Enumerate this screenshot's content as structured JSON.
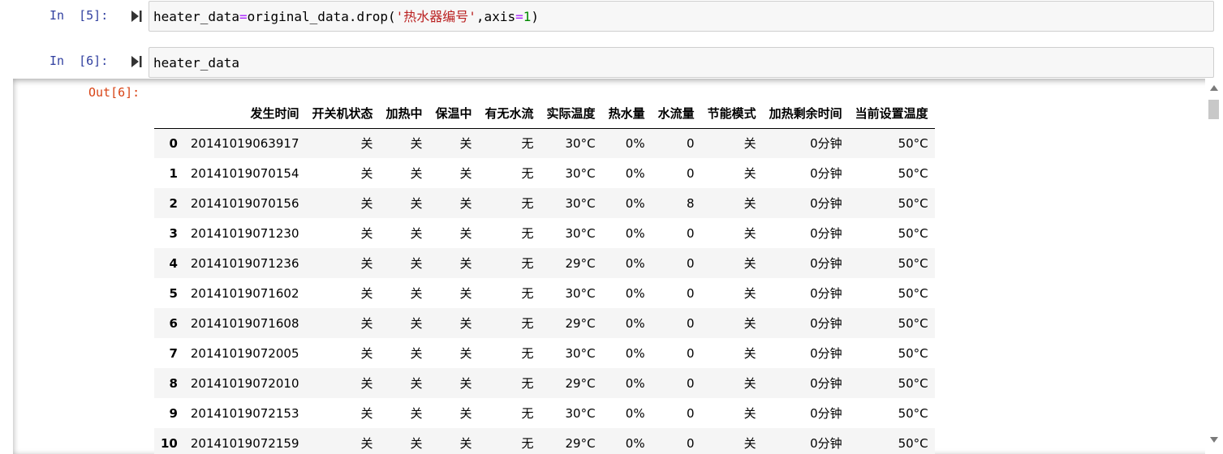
{
  "cells": [
    {
      "prompt": "In  [5]:",
      "code_tokens": [
        {
          "t": "heater_data",
          "c": ""
        },
        {
          "t": "=",
          "c": "op"
        },
        {
          "t": "original_data.drop(",
          "c": ""
        },
        {
          "t": "'热水器编号'",
          "c": "str"
        },
        {
          "t": ",axis",
          "c": ""
        },
        {
          "t": "=",
          "c": "op"
        },
        {
          "t": "1",
          "c": "num"
        },
        {
          "t": ")",
          "c": ""
        }
      ]
    },
    {
      "prompt": "In  [6]:",
      "code_tokens": [
        {
          "t": "heater_data",
          "c": ""
        }
      ]
    }
  ],
  "output": {
    "prompt": "Out[6]:",
    "columns": [
      "发生时间",
      "开关机状态",
      "加热中",
      "保温中",
      "有无水流",
      "实际温度",
      "热水量",
      "水流量",
      "节能模式",
      "加热剩余时间",
      "当前设置温度"
    ],
    "rows": [
      {
        "index": "0",
        "cells": [
          "20141019063917",
          "关",
          "关",
          "关",
          "无",
          "30°C",
          "0%",
          "0",
          "关",
          "0分钟",
          "50°C"
        ]
      },
      {
        "index": "1",
        "cells": [
          "20141019070154",
          "关",
          "关",
          "关",
          "无",
          "30°C",
          "0%",
          "0",
          "关",
          "0分钟",
          "50°C"
        ]
      },
      {
        "index": "2",
        "cells": [
          "20141019070156",
          "关",
          "关",
          "关",
          "无",
          "30°C",
          "0%",
          "8",
          "关",
          "0分钟",
          "50°C"
        ]
      },
      {
        "index": "3",
        "cells": [
          "20141019071230",
          "关",
          "关",
          "关",
          "无",
          "30°C",
          "0%",
          "0",
          "关",
          "0分钟",
          "50°C"
        ]
      },
      {
        "index": "4",
        "cells": [
          "20141019071236",
          "关",
          "关",
          "关",
          "无",
          "29°C",
          "0%",
          "0",
          "关",
          "0分钟",
          "50°C"
        ]
      },
      {
        "index": "5",
        "cells": [
          "20141019071602",
          "关",
          "关",
          "关",
          "无",
          "30°C",
          "0%",
          "0",
          "关",
          "0分钟",
          "50°C"
        ]
      },
      {
        "index": "6",
        "cells": [
          "20141019071608",
          "关",
          "关",
          "关",
          "无",
          "29°C",
          "0%",
          "0",
          "关",
          "0分钟",
          "50°C"
        ]
      },
      {
        "index": "7",
        "cells": [
          "20141019072005",
          "关",
          "关",
          "关",
          "无",
          "30°C",
          "0%",
          "0",
          "关",
          "0分钟",
          "50°C"
        ]
      },
      {
        "index": "8",
        "cells": [
          "20141019072010",
          "关",
          "关",
          "关",
          "无",
          "29°C",
          "0%",
          "0",
          "关",
          "0分钟",
          "50°C"
        ]
      },
      {
        "index": "9",
        "cells": [
          "20141019072153",
          "关",
          "关",
          "关",
          "无",
          "30°C",
          "0%",
          "0",
          "关",
          "0分钟",
          "50°C"
        ]
      },
      {
        "index": "10",
        "cells": [
          "20141019072159",
          "关",
          "关",
          "关",
          "无",
          "29°C",
          "0%",
          "0",
          "关",
          "0分钟",
          "50°C"
        ]
      }
    ]
  },
  "icons": {
    "run": "run-cell-icon",
    "scroll_up": "scroll-up-arrow-icon",
    "scroll_down": "scroll-down-arrow-icon"
  },
  "colors": {
    "prompt_in": "#303f9f",
    "prompt_out": "#d84315",
    "string": "#ba2121",
    "operator": "#aa22ff",
    "number": "#008800"
  }
}
